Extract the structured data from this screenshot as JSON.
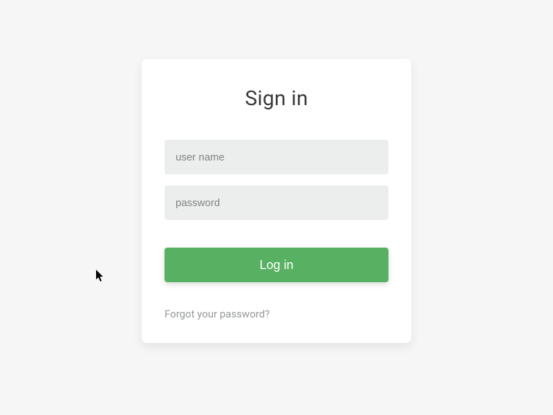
{
  "card": {
    "title": "Sign in",
    "username_placeholder": "user name",
    "password_placeholder": "password",
    "login_label": "Log in",
    "forgot_label": "Forgot your password?"
  }
}
